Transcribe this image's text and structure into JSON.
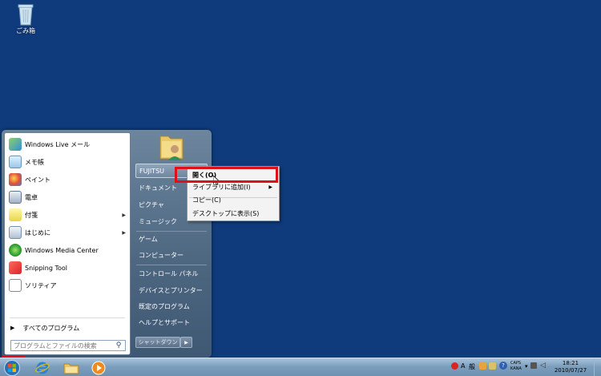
{
  "desktop": {
    "recycle_bin_label": "ごみ箱"
  },
  "start_menu": {
    "programs": [
      {
        "label": "Windows Live メール",
        "icon": "mail-icon",
        "has_submenu": false
      },
      {
        "label": "メモ帳",
        "icon": "notepad-icon",
        "has_submenu": false
      },
      {
        "label": "ペイント",
        "icon": "paint-icon",
        "has_submenu": false
      },
      {
        "label": "電卓",
        "icon": "calculator-icon",
        "has_submenu": false
      },
      {
        "label": "付箋",
        "icon": "sticky-notes-icon",
        "has_submenu": true
      },
      {
        "label": "はじめに",
        "icon": "getting-started-icon",
        "has_submenu": true
      },
      {
        "label": "Windows Media Center",
        "icon": "media-center-icon",
        "has_submenu": false
      },
      {
        "label": "Snipping Tool",
        "icon": "snipping-tool-icon",
        "has_submenu": false
      },
      {
        "label": "ソリティア",
        "icon": "solitaire-icon",
        "has_submenu": false
      }
    ],
    "all_programs_label": "すべてのプログラム",
    "search_placeholder": "プログラムとファイルの検索",
    "right_items": [
      {
        "label": "FUJITSU"
      },
      {
        "label": "ドキュメント"
      },
      {
        "label": "ピクチャ"
      },
      {
        "label": "ミュージック"
      },
      {
        "label": "ゲーム"
      },
      {
        "label": "コンピューター"
      },
      {
        "label": "コントロール パネル"
      },
      {
        "label": "デバイスとプリンター"
      },
      {
        "label": "既定のプログラム"
      },
      {
        "label": "ヘルプとサポート"
      }
    ],
    "shutdown_label": "シャットダウン"
  },
  "context_menu": {
    "items": [
      {
        "label": "開く(O)",
        "bold": true,
        "has_submenu": false
      },
      {
        "label": "ライブラリに追加(I)",
        "bold": false,
        "has_submenu": true
      },
      {
        "label": "コピー(C)",
        "bold": false,
        "has_submenu": false
      },
      {
        "label": "デスクトップに表示(S)",
        "bold": false,
        "has_submenu": false
      }
    ]
  },
  "taskbar": {
    "pinned": [
      "internet-explorer-icon",
      "explorer-folder-icon",
      "media-player-icon"
    ],
    "ime_mode": "A",
    "ime_label": "般",
    "caps": "CAPS",
    "kana": "KANA",
    "time": "18:21",
    "date": "2010/07/27"
  },
  "colors": {
    "desktop": "#0f3b7c",
    "highlight_box": "#e0101a"
  }
}
